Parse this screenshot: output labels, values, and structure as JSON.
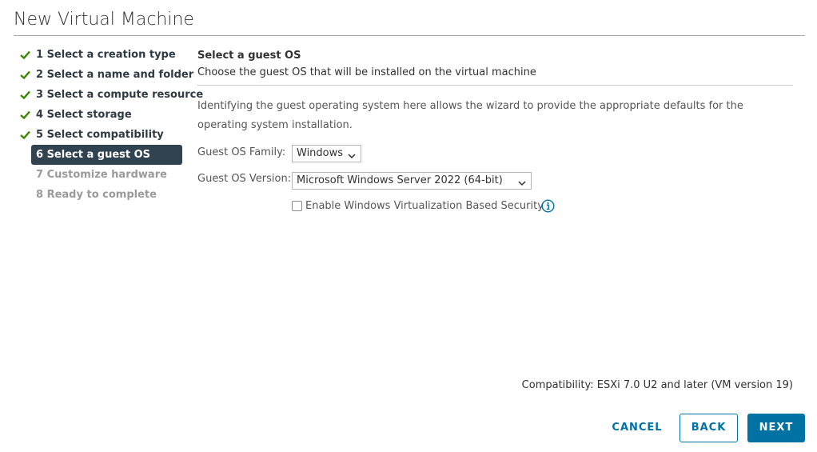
{
  "dialog": {
    "title": "New Virtual Machine"
  },
  "steps": [
    {
      "label": "1 Select a creation type",
      "state": "done"
    },
    {
      "label": "2 Select a name and folder",
      "state": "done"
    },
    {
      "label": "3 Select a compute resource",
      "state": "done"
    },
    {
      "label": "4 Select storage",
      "state": "done"
    },
    {
      "label": "5 Select compatibility",
      "state": "done"
    },
    {
      "label": "6 Select a guest OS",
      "state": "active"
    },
    {
      "label": "7 Customize hardware",
      "state": "todo"
    },
    {
      "label": "8 Ready to complete",
      "state": "todo"
    }
  ],
  "section": {
    "title": "Select a guest OS",
    "subtitle": "Choose the guest OS that will be installed on the virtual machine",
    "description": "Identifying the guest operating system here allows the wizard to provide the appropriate defaults for the operating system installation."
  },
  "form": {
    "family_label": "Guest OS Family:",
    "family_value": "Windows",
    "version_label": "Guest OS Version:",
    "version_value": "Microsoft Windows Server 2022 (64-bit)",
    "vbs_label": "Enable Windows Virtualization Based Security",
    "vbs_checked": false
  },
  "footer": {
    "compatibility": "Compatibility: ESXi 7.0 U2 and later (VM version 19)",
    "cancel_label": "CANCEL",
    "back_label": "BACK",
    "next_label": "NEXT"
  },
  "colors": {
    "accent": "#0072a3",
    "check_green": "#3c8500",
    "active_step_bg": "#314351",
    "disabled_text": "#9a9a9a"
  },
  "icons": {
    "done_step": "checkmark-icon",
    "info": "info-icon",
    "dropdown": "chevron-down-icon"
  }
}
